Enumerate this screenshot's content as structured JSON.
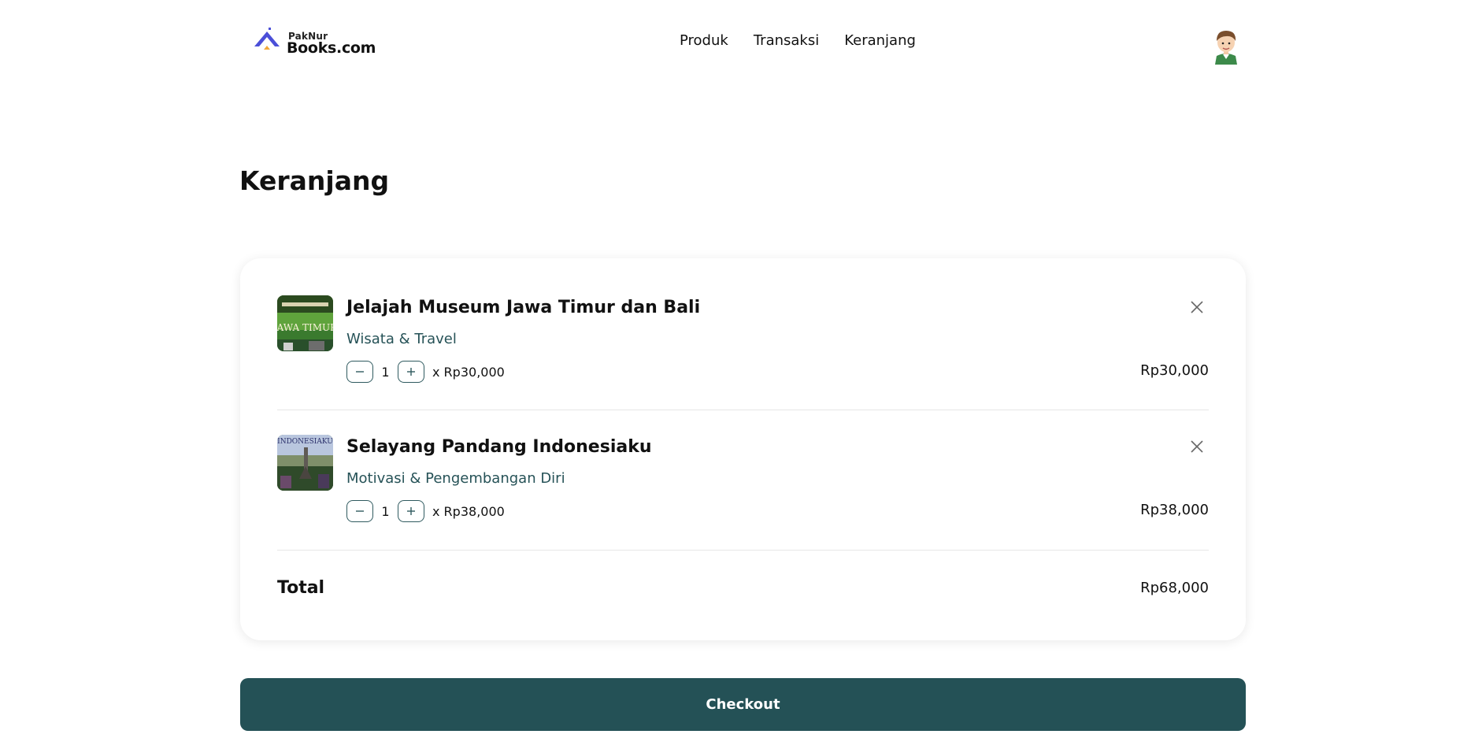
{
  "brand": {
    "small": "PakNur",
    "big": "Books.com"
  },
  "nav": {
    "links": [
      "Produk",
      "Transaksi",
      "Keranjang"
    ]
  },
  "page": {
    "title": "Keranjang"
  },
  "cart": {
    "items": [
      {
        "title": "Jelajah Museum Jawa Timur dan Bali",
        "category": "Wisata & Travel",
        "qty": "1",
        "unit_price": "x Rp30,000",
        "line_total": "Rp30,000",
        "cover_text": "JAWA TIMUR"
      },
      {
        "title": "Selayang Pandang Indonesiaku",
        "category": "Motivasi & Pengembangan Diri",
        "qty": "1",
        "unit_price": "x Rp38,000",
        "line_total": "Rp38,000",
        "cover_text": "INDONESIAKU"
      }
    ],
    "total_label": "Total",
    "total_value": "Rp68,000"
  },
  "checkout_label": "Checkout",
  "colors": {
    "accent": "#245156",
    "category_text": "#265257",
    "logo_blue": "#4b4fd8"
  }
}
